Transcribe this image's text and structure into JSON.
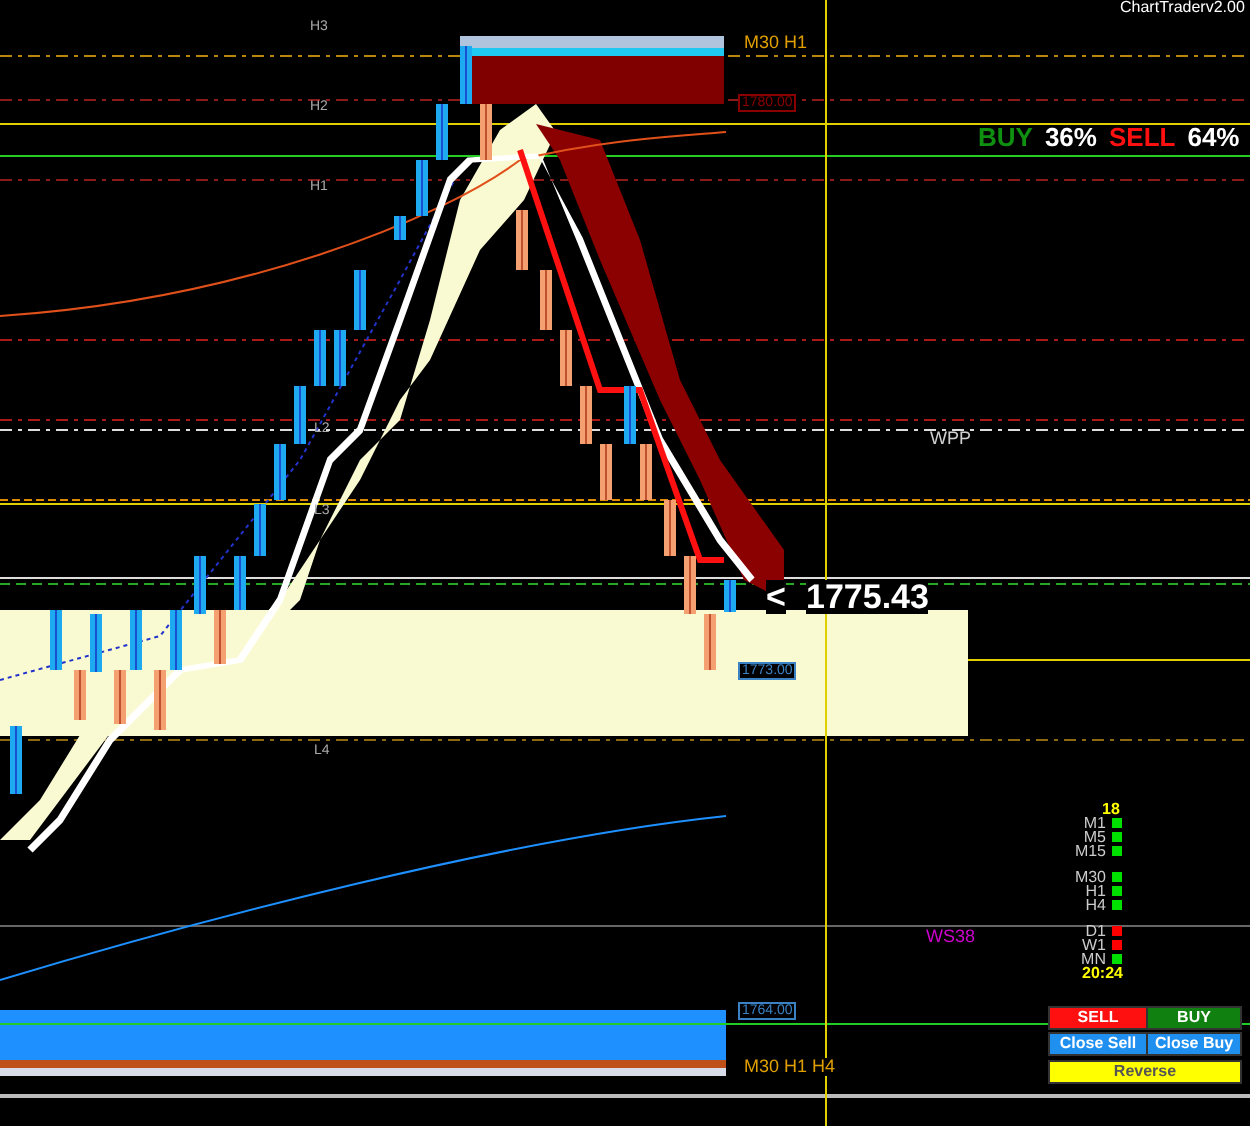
{
  "header": {
    "title": "ChartTraderv2.00"
  },
  "levels": [
    {
      "label": "H3"
    },
    {
      "label": "H2"
    },
    {
      "label": "H1"
    },
    {
      "label": "L2"
    },
    {
      "label": "L3"
    },
    {
      "label": "L4"
    }
  ],
  "zone_labels": [
    {
      "text": "M30 H1"
    },
    {
      "text": "M30 H1 H4"
    }
  ],
  "price_tags": [
    {
      "text": "1780.00",
      "color": "#8b0000"
    },
    {
      "text": "1773.00",
      "color": "#3b82c4"
    },
    {
      "text": "1764.00",
      "color": "#3b82c4"
    }
  ],
  "sentiment": {
    "buy_label": "BUY",
    "buy_value": "36%",
    "sell_label": "SELL",
    "sell_value": "64%"
  },
  "pivot_labels": [
    {
      "text": "WPP",
      "color": "#d0d0d0"
    },
    {
      "text": "WS38",
      "color": "#cc00cc"
    }
  ],
  "current_price": {
    "marker": "<",
    "value": "1775.43"
  },
  "timeframes": {
    "count": "18",
    "time": "20:24",
    "items": [
      {
        "label": "M1",
        "color": "#00e000"
      },
      {
        "label": "M5",
        "color": "#00e000"
      },
      {
        "label": "M15",
        "color": "#00e000"
      },
      {
        "label": "M30",
        "color": "#00e000"
      },
      {
        "label": "H1",
        "color": "#00e000"
      },
      {
        "label": "H4",
        "color": "#00e000"
      },
      {
        "label": "D1",
        "color": "#ff0000"
      },
      {
        "label": "W1",
        "color": "#ff0000"
      },
      {
        "label": "MN",
        "color": "#00e000"
      }
    ]
  },
  "buttons": [
    {
      "label": "SELL",
      "kind": "sell"
    },
    {
      "label": "BUY",
      "kind": "buy"
    },
    {
      "label": "Close Sell",
      "kind": "close"
    },
    {
      "label": "Close Buy",
      "kind": "close"
    },
    {
      "label": "Reverse",
      "kind": "reverse"
    }
  ]
}
